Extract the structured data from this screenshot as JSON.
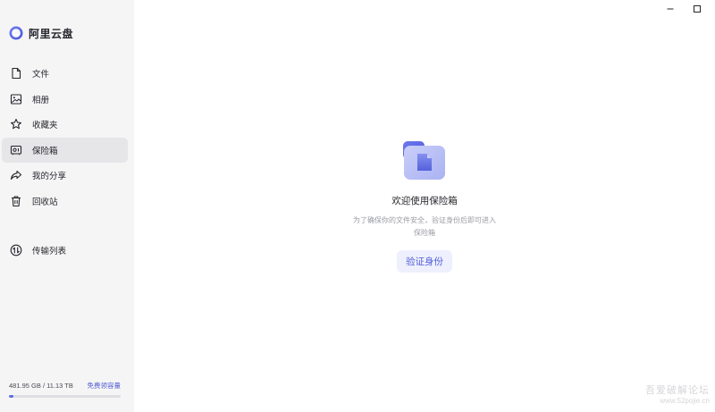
{
  "app": {
    "name": "阿里云盘"
  },
  "window": {
    "minimize_icon": "minimize-icon",
    "maximize_icon": "maximize-icon"
  },
  "sidebar": {
    "items": [
      {
        "label": "文件",
        "icon": "file-icon",
        "active": false
      },
      {
        "label": "相册",
        "icon": "photo-album-icon",
        "active": false
      },
      {
        "label": "收藏夹",
        "icon": "star-icon",
        "active": false
      },
      {
        "label": "保险箱",
        "icon": "safe-icon",
        "active": true
      },
      {
        "label": "我的分享",
        "icon": "share-icon",
        "active": false
      },
      {
        "label": "回收站",
        "icon": "trash-icon",
        "active": false
      }
    ],
    "transfer": {
      "label": "传输列表",
      "icon": "transfer-icon"
    },
    "storage": {
      "used_text": "481.95 GB / 11.13 TB",
      "link_label": "免费领容量",
      "used_fraction": 0.042
    }
  },
  "main": {
    "title": "欢迎使用保险箱",
    "description": "为了确保你的文件安全，验证身份后即可进入保险箱",
    "button_label": "验证身份"
  },
  "watermark": {
    "line1": "吾爱破解论坛",
    "line2": "www.52pojie.cn"
  },
  "colors": {
    "accent": "#5f6ce5",
    "sidebar_bg": "#f5f5f6",
    "active_item_bg": "#e6e6e9",
    "button_bg": "#eef0fd",
    "button_text": "#5360d8"
  }
}
